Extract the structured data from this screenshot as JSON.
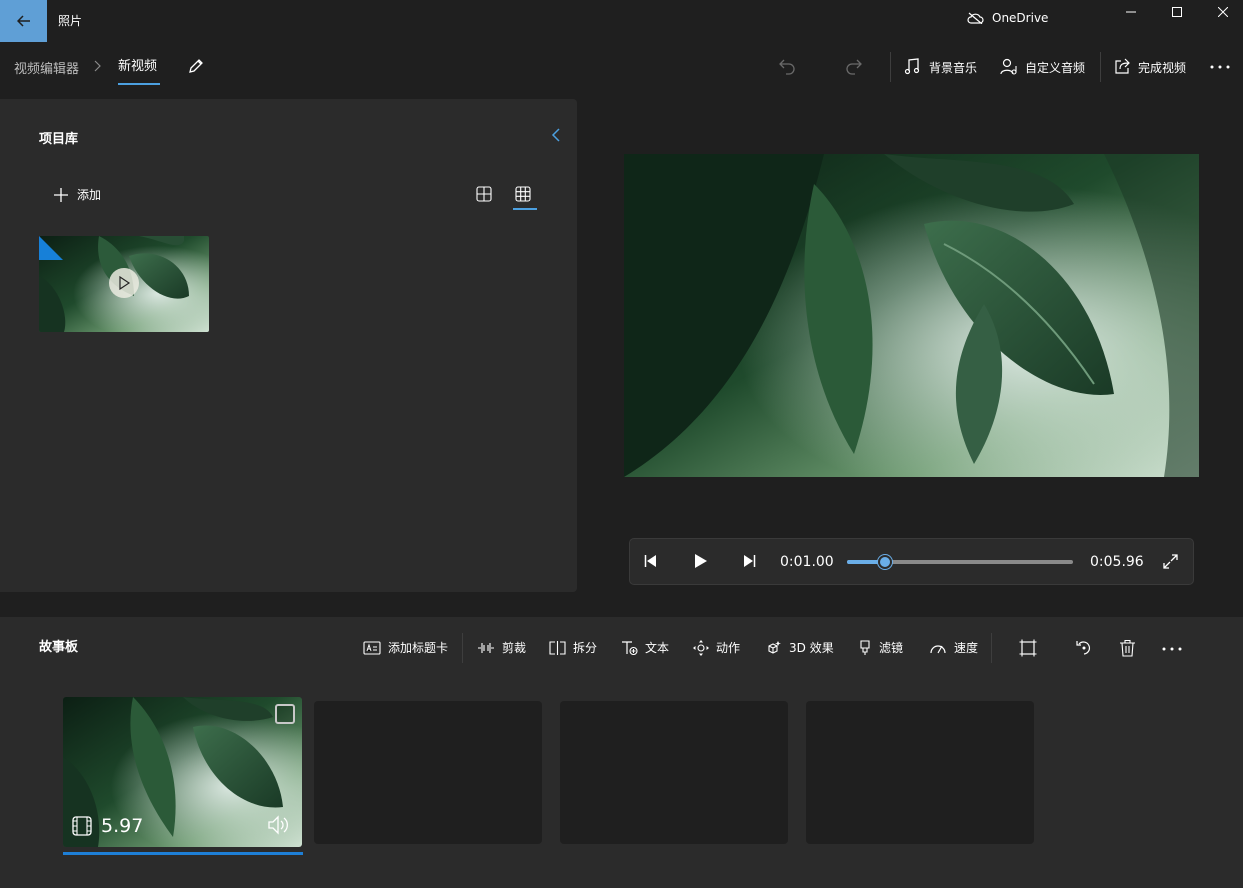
{
  "app": {
    "title": "照片",
    "onedrive_label": "OneDrive"
  },
  "breadcrumb": {
    "root": "视频编辑器",
    "current": "新视频"
  },
  "commands": {
    "background_music": "背景音乐",
    "custom_audio": "自定义音频",
    "finish_video": "完成视频"
  },
  "library": {
    "title": "项目库",
    "add_label": "添加",
    "selected_view": "large-grid"
  },
  "player": {
    "current_time": "0:01.00",
    "total_time": "0:05.96",
    "progress": 0.168
  },
  "storyboard": {
    "title": "故事板",
    "tools": [
      {
        "label": "添加标题卡",
        "icon": "title-card-icon"
      },
      {
        "label": "剪裁",
        "icon": "trim-icon"
      },
      {
        "label": "拆分",
        "icon": "split-icon"
      },
      {
        "label": "文本",
        "icon": "text-icon"
      },
      {
        "label": "动作",
        "icon": "motion-icon"
      },
      {
        "label": "3D 效果",
        "icon": "effects-3d-icon"
      },
      {
        "label": "滤镜",
        "icon": "filter-icon"
      },
      {
        "label": "速度",
        "icon": "speed-icon"
      }
    ],
    "clip": {
      "duration": "5.97"
    }
  },
  "colors": {
    "accent": "#1e7fd6",
    "back_button": "#5f9fd6",
    "panel": "#2b2b2b",
    "background": "#1f1f1f"
  }
}
